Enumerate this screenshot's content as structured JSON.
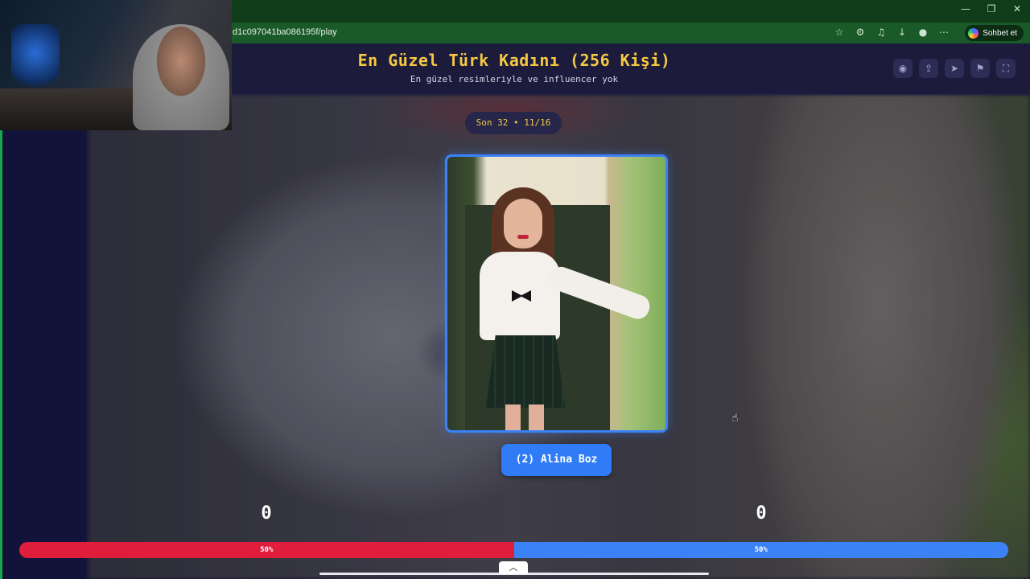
{
  "browser": {
    "url": "d1c097041ba086195f/play",
    "copilot_label": "Sohbet et",
    "window_controls": [
      "minimize-icon",
      "restore-icon",
      "close-icon"
    ],
    "toolbar_icons": [
      "star-icon",
      "extensions-icon",
      "profile-sync-icon",
      "download-icon",
      "avatar-icon",
      "more-icon"
    ]
  },
  "header": {
    "title": "En Güzel Türk Kadını (256 Kişi)",
    "subtitle": "En güzel resimleriyle ve influencer yok",
    "actions": [
      "eye-icon",
      "share-icon",
      "send-icon",
      "flag-icon",
      "fullscreen-icon"
    ]
  },
  "game": {
    "round_label": "Son 32 • 11/16",
    "contestant_label": "(2) Alina Boz",
    "score_left": "0",
    "score_right": "0",
    "vote_left_pct": 50,
    "vote_right_pct": 50,
    "vote_left_label": "50%",
    "vote_right_label": "50%"
  },
  "colors": {
    "title": "#f5c842",
    "accent_blue": "#3b82f6",
    "accent_red": "#e01e3c",
    "header_bg": "#1c1b3b"
  }
}
